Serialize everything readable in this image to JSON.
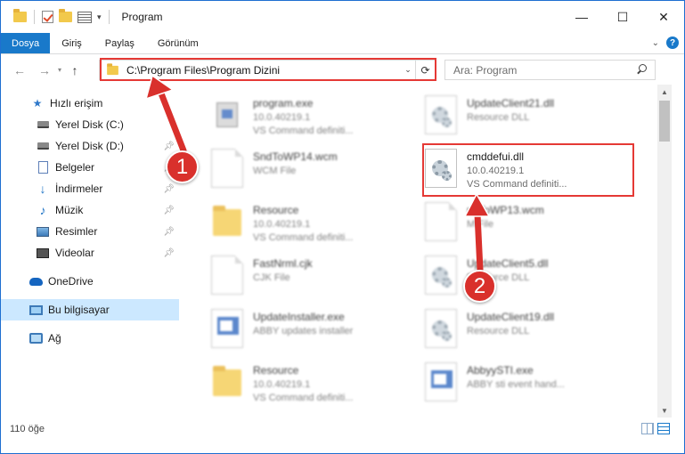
{
  "window": {
    "title": "Program",
    "minimize_glyph": "—",
    "maximize_glyph": "☐",
    "close_glyph": "✕",
    "accent": "#1979ca"
  },
  "ribbon": {
    "tabs": [
      "Dosya",
      "Giriş",
      "Paylaş",
      "Görünüm"
    ],
    "active_tab": "Dosya",
    "help_glyph": "?"
  },
  "nav": {
    "back_glyph": "←",
    "forward_glyph": "→",
    "recent_glyph": "▾",
    "up_glyph": "↑",
    "address": "C:\\Program Files\\Program Dizini",
    "search_placeholder": "Ara: Program"
  },
  "sidebar": {
    "items": [
      {
        "label": "Hızlı erişim",
        "icon": "star-icon",
        "pinned": false
      },
      {
        "label": "Yerel Disk (C:)",
        "icon": "drive-icon",
        "pinned": false
      },
      {
        "label": "Yerel Disk (D:)",
        "icon": "drive-icon",
        "pinned": true
      },
      {
        "label": "Belgeler",
        "icon": "document-icon",
        "pinned": true
      },
      {
        "label": "İndirmeler",
        "icon": "download-icon",
        "pinned": true
      },
      {
        "label": "Müzik",
        "icon": "music-icon",
        "pinned": true
      },
      {
        "label": "Resimler",
        "icon": "pictures-icon",
        "pinned": true
      },
      {
        "label": "Videolar",
        "icon": "video-icon",
        "pinned": true
      },
      {
        "label": "OneDrive",
        "icon": "onedrive-icon",
        "pinned": false
      },
      {
        "label": "Bu bilgisayar",
        "icon": "computer-icon",
        "pinned": false
      },
      {
        "label": "Ağ",
        "icon": "network-icon",
        "pinned": false
      }
    ],
    "selected": "Bu bilgisayar"
  },
  "files": [
    {
      "name": "program.exe",
      "line2": "10.0.40219.1",
      "line3": "VS Command definiti...",
      "icon": "exe"
    },
    {
      "name": "UpdateClient21.dll",
      "line2": "Resource DLL",
      "line3": "",
      "icon": "gear"
    },
    {
      "name": "SndToWP14.wcm",
      "line2": "WCM File",
      "line3": "",
      "icon": "doc"
    },
    {
      "name": "cmddefui.dll",
      "line2": "10.0.40219.1",
      "line3": "VS Command definiti...",
      "icon": "gear"
    },
    {
      "name": "Resource",
      "line2": "10.0.40219.1",
      "line3": "VS Command definiti...",
      "icon": "folder"
    },
    {
      "name": "ndToWP13.wcm",
      "line2": "M File",
      "line3": "",
      "icon": "doc"
    },
    {
      "name": "FastNrml.cjk",
      "line2": "CJK File",
      "line3": "",
      "icon": "doc"
    },
    {
      "name": "UpdateClient5.dll",
      "line2": "Resource DLL",
      "line3": "",
      "icon": "gear"
    },
    {
      "name": "UpdateInstaller.exe",
      "line2": "ABBY updates installer",
      "line3": "",
      "icon": "app"
    },
    {
      "name": "UpdateClient19.dll",
      "line2": "Resource DLL",
      "line3": "",
      "icon": "gear"
    },
    {
      "name": "Resource",
      "line2": "10.0.40219.1",
      "line3": "VS Command definiti...",
      "icon": "folder"
    },
    {
      "name": "AbbyySTI.exe",
      "line2": "ABBY sti event hand...",
      "line3": "",
      "icon": "app"
    }
  ],
  "status": {
    "count_text": "110 öğe"
  },
  "callouts": [
    "1",
    "2"
  ],
  "colors": {
    "highlight": "#e53935",
    "callout": "#d9302c",
    "selected_bg": "#cce8ff"
  }
}
